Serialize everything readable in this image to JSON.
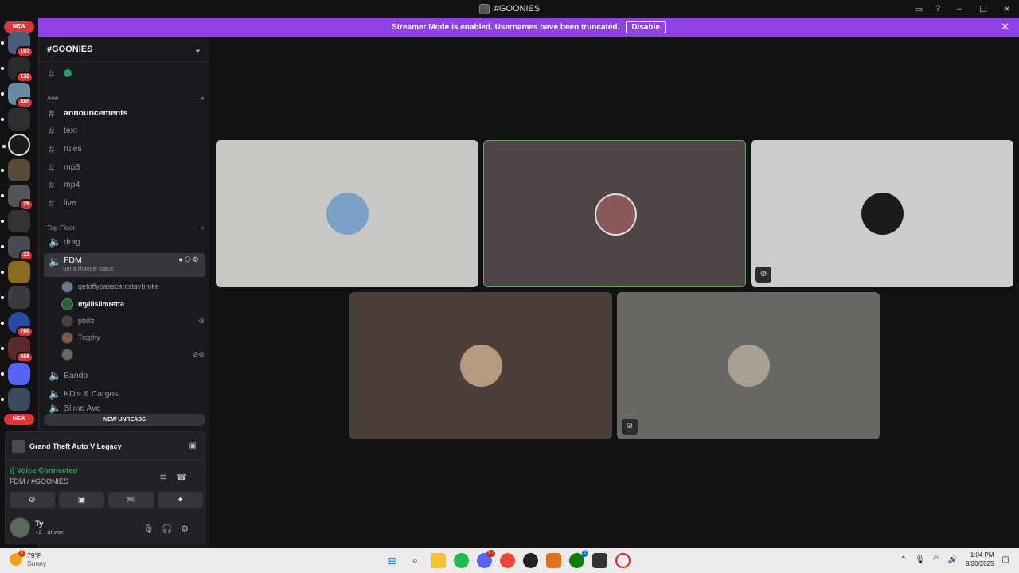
{
  "window": {
    "title": "#GOONIES"
  },
  "banner": {
    "text": "Streamer Mode is enabled. Usernames have been truncated.",
    "disable_label": "Disable"
  },
  "rail": {
    "top_pill": "NEW",
    "bottom_pill": "NEW",
    "badges": [
      "103",
      "132",
      "480",
      "29",
      "22",
      "760",
      "568"
    ]
  },
  "guild": {
    "name": "#GOONIES"
  },
  "categories": {
    "ave": "Ave",
    "top_floor": "Top Floor"
  },
  "channels": {
    "ave": [
      "announcements",
      "text",
      "rules",
      "mp3",
      "mp4",
      "live"
    ],
    "voice": [
      "drag",
      "FDM",
      "Bando",
      "KD's & Cargos",
      "Slime Ave"
    ]
  },
  "fdm": {
    "status_hint": "Set a channel status"
  },
  "voice_users": [
    "getoffyoasscantstaybroke",
    "mylilslimretta",
    "pbillz",
    "Trophy",
    ""
  ],
  "new_unreads": "NEW UNREADS",
  "activity": {
    "game": "Grand Theft Auto V Legacy"
  },
  "voice": {
    "status": "Voice Connected",
    "location": "FDM / #GOONIES"
  },
  "user": {
    "name": "Ty",
    "status": "at war",
    "status_prefix": "+2 ·"
  },
  "taskbar": {
    "temp": "79°F",
    "condition": "Sunny",
    "weather_badge": "2",
    "discord_badge": "9+",
    "xbox_badge": "2",
    "time": "1:04 PM",
    "date": "8/20/2025"
  },
  "colors": {
    "accent_banner": "#8f42e4",
    "voice_green": "#23a55a",
    "badge_red": "#da373c",
    "speaking_border": "#5ea65a"
  }
}
